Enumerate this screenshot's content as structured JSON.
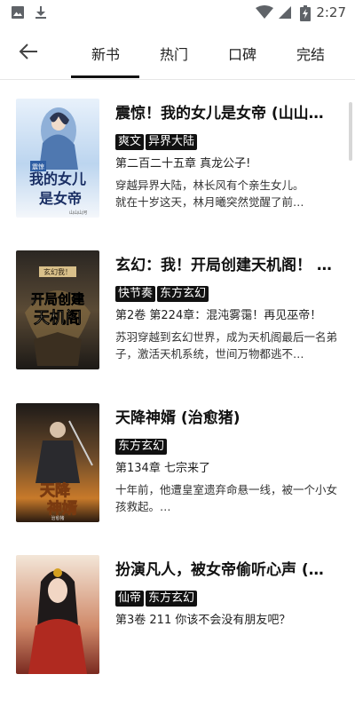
{
  "status_bar": {
    "time": "2:27"
  },
  "tabs": [
    {
      "label": "新书",
      "active": true
    },
    {
      "label": "热门"
    },
    {
      "label": "口碑"
    },
    {
      "label": "完结"
    }
  ],
  "books": [
    {
      "title": "震惊！我的女儿是女帝 (山山…",
      "tags": [
        "爽文",
        "异界大陆"
      ],
      "chapter": "第二百二十五章 真龙公子!",
      "description": "穿越异界大陆，林长风有个亲生女儿。\n        就在十岁这天，林月曦突然觉醒了前…",
      "cover_text": "我的女儿是女帝",
      "cover_badge": "震惊",
      "cover_author": "山山山河"
    },
    {
      "title": "玄幻：我！开局创建天机阁！ …",
      "tags": [
        "快节奏",
        "东方玄幻"
      ],
      "chapter": "第2卷 第224章：混沌雾霭！再见巫帝！",
      "description": "苏羽穿越到玄幻世界，成为天机阁最后一名弟子，激活天机系统，世间万物都逃不…",
      "cover_text": "开局创建天机阁",
      "cover_badge": "玄幻我！"
    },
    {
      "title": "天降神婿 (治愈猪)",
      "tags": [
        "东方玄幻"
      ],
      "chapter": "第134章 七宗来了",
      "description": "十年前，他遭皇室遗弃命悬一线，被一个小女孩救起。…",
      "cover_text": "天降神婿",
      "cover_author": "治愈猪"
    },
    {
      "title": "扮演凡人，被女帝偷听心声 (山…",
      "tags": [
        "仙帝",
        "东方玄幻"
      ],
      "chapter": "第3卷 211 你该不会没有朋友吧？",
      "description": "",
      "cover_text": ""
    }
  ],
  "colors": {
    "tag_bg": "#111111",
    "tag_text": "#ffffff",
    "accent": "#111111"
  }
}
